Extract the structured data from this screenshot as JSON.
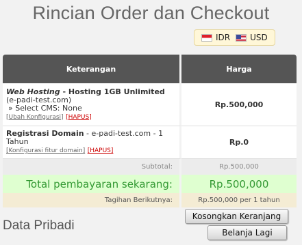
{
  "page": {
    "title": "Rincian Order dan Checkout",
    "section_title": "Data Pribadi"
  },
  "currency": {
    "options": [
      {
        "code": "IDR",
        "icon": "flag-indonesia-icon"
      },
      {
        "code": "USD",
        "icon": "flag-usa-icon"
      }
    ]
  },
  "table": {
    "headers": {
      "description": "Keterangan",
      "price": "Harga"
    },
    "items": [
      {
        "name": "Web Hosting",
        "separator": " - ",
        "product": "Hosting 1GB Unlimited",
        "detail": " (e-padi-test.com)",
        "option": "» Select CMS: None",
        "link": "[Ubah Konfigurasi]",
        "remove": "[HAPUS]",
        "price": "Rp.500,000"
      },
      {
        "name": "Registrasi Domain",
        "detail": " - e-padi-test.com - 1 Tahun",
        "link": "[Konfigurasi fitur domain]",
        "remove": "[HAPUS]",
        "price": "Rp.0"
      }
    ],
    "subtotal": {
      "label": "Subtotal:",
      "value": "Rp.500,000"
    },
    "total": {
      "label": "Total pembayaran sekarang:",
      "value": "Rp.500,000"
    },
    "recurring": {
      "label": "Tagihan Berikutnya:",
      "value": "Rp.500,000 per 1 tahun"
    }
  },
  "buttons": {
    "empty_cart": "Kosongkan Keranjang",
    "continue_shopping": "Belanja Lagi"
  },
  "colors": {
    "header_bg": "#555555",
    "total_bg": "#dfffd0",
    "total_text": "#339933",
    "recurring_bg": "#f4ecd4",
    "remove_link": "#cc0000"
  }
}
